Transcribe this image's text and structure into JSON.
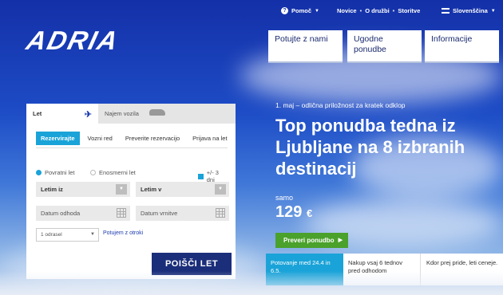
{
  "topbar": {
    "help_label": "Pomoč",
    "links": [
      "Novice",
      "O družbi",
      "Storitve"
    ],
    "language": "Slovenščina"
  },
  "brand": {
    "logo_text": "ADRIA"
  },
  "menu": [
    {
      "label": "Potujte z nami"
    },
    {
      "label": "Ugodne ponudbe"
    },
    {
      "label": "Informacije"
    }
  ],
  "booking": {
    "tabs": {
      "flight": "Let",
      "car": "Najem vozila"
    },
    "subnav": [
      "Rezervirajte",
      "Vozni red",
      "Preverite rezervacijo",
      "Prijava na let"
    ],
    "trip_type": {
      "return": "Povratni let",
      "oneway": "Enosmerni let",
      "flexible": "+/- 3 dni"
    },
    "from_value": "Letim iz",
    "to_value": "Letim v",
    "depart_placeholder": "Datum odhoda",
    "return_placeholder": "Datum vrnitve",
    "passengers_value": "1 odrasel",
    "kids_link": "Potujem z otroki",
    "search_label": "POIŠČI LET"
  },
  "promo": {
    "date_line": "1. maj – odlična priložnost za kratek odklop",
    "title": "Top ponudba tedna iz Ljubljane na 8 izbranih destinacij",
    "from_label": "samo",
    "price": "129",
    "currency": "€",
    "cta_label": "Preveri ponudbo"
  },
  "info_strip": [
    "Potovanje med 24.4 in 6.5.",
    "Nakup vsaj 6 tednov pred odhodom",
    "Kdor prej pride, leti ceneje."
  ],
  "colors": {
    "brand_blue": "#1b2e7a",
    "accent_cyan": "#1aa3d8",
    "cta_green": "#4aa12b"
  },
  "icons": [
    "help-icon",
    "flag-icon",
    "plane-icon",
    "car-icon",
    "dropdown-icon",
    "calendar-icon",
    "arrow-right-icon"
  ]
}
